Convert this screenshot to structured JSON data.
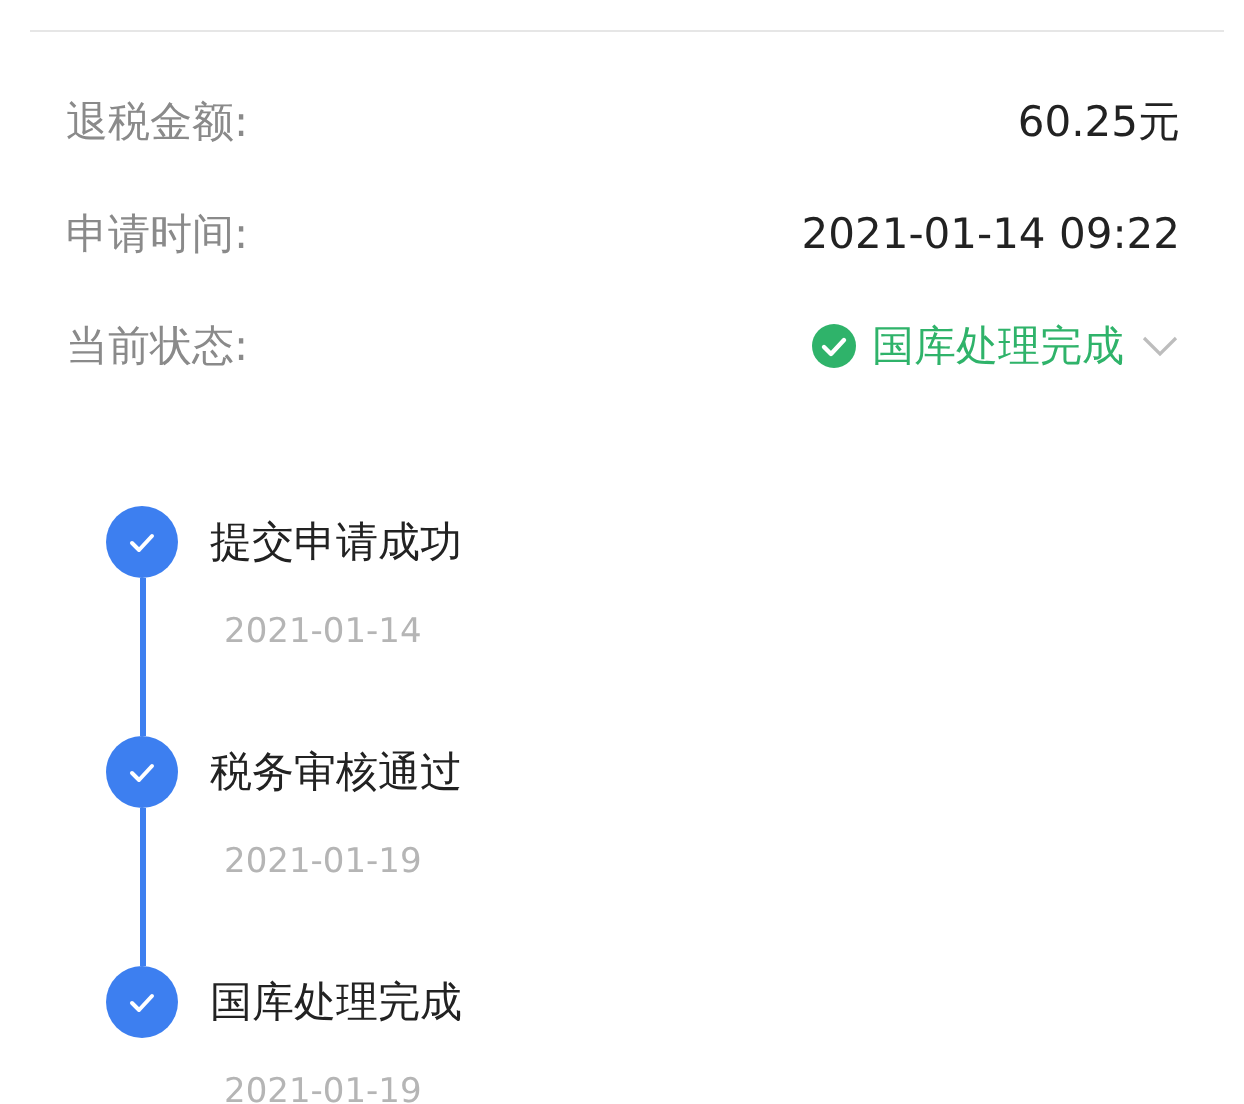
{
  "summary": [
    {
      "kind": "text",
      "label": "退税金额:",
      "value": "60.25元"
    },
    {
      "kind": "text",
      "label": "申请时间:",
      "value": "2021-01-14 09:22"
    },
    {
      "kind": "status",
      "label": "当前状态:",
      "value": "国库处理完成"
    }
  ],
  "timeline": [
    {
      "title": "提交申请成功",
      "date": "2021-01-14",
      "done": true
    },
    {
      "title": "税务审核通过",
      "date": "2021-01-19",
      "done": true
    },
    {
      "title": "国库处理完成",
      "date": "2021-01-19",
      "done": true
    }
  ]
}
